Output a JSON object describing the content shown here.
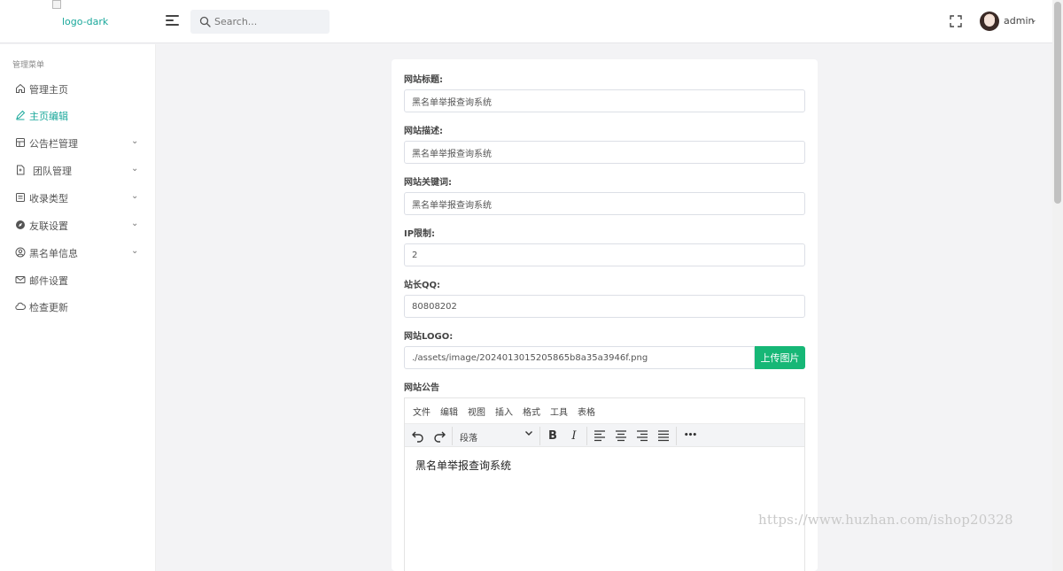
{
  "header": {
    "logo_alt": "logo-dark",
    "search_placeholder": "Search...",
    "user_name": "admin",
    "user_caret": "⌄"
  },
  "sidebar": {
    "title": "管理菜单",
    "items": [
      {
        "label": "管理主页",
        "icon": "home-icon",
        "has_caret": false,
        "active": false
      },
      {
        "label": "主页编辑",
        "icon": "edit-icon",
        "has_caret": false,
        "active": true
      },
      {
        "label": "公告栏管理",
        "icon": "layout-icon",
        "has_caret": true,
        "active": false
      },
      {
        "label": "团队管理",
        "icon": "file-icon",
        "has_caret": true,
        "active": false
      },
      {
        "label": "收录类型",
        "icon": "list-icon",
        "has_caret": true,
        "active": false
      },
      {
        "label": "友联设置",
        "icon": "compass-icon",
        "has_caret": true,
        "active": false
      },
      {
        "label": "黑名单信息",
        "icon": "user-pin-icon",
        "has_caret": true,
        "active": false
      },
      {
        "label": "邮件设置",
        "icon": "mail-icon",
        "has_caret": false,
        "active": false
      },
      {
        "label": "检查更新",
        "icon": "cloud-icon",
        "has_caret": false,
        "active": false
      }
    ],
    "caret": "⌄"
  },
  "form": {
    "site_title": {
      "label": "网站标题:",
      "value": "黑名单举报查询系统"
    },
    "site_description": {
      "label": "网站描述:",
      "value": "黑名单举报查询系统"
    },
    "site_keywords": {
      "label": "网站关键词:",
      "value": "黑名单举报查询系统"
    },
    "ip_limit": {
      "label": "IP限制:",
      "value": "2"
    },
    "admin_qq": {
      "label": "站长QQ:",
      "value": "80808202"
    },
    "site_logo": {
      "label": "网站LOGO:",
      "value": "./assets/image/2024013015205865b8a35a3946f.png",
      "upload_label": "上传图片"
    },
    "announcement": {
      "label": "网站公告"
    }
  },
  "editor": {
    "menu": [
      "文件",
      "编辑",
      "视图",
      "插入",
      "格式",
      "工具",
      "表格"
    ],
    "format_select": "段落",
    "bold": "B",
    "italic": "I",
    "more": "•••",
    "content": "黑名单举报查询系统"
  },
  "watermark": "https://www.huzhan.com/ishop20328",
  "colors": {
    "accent": "#1aa89b",
    "upload_button": "#16b776",
    "page_bg": "#f3f3f5"
  }
}
